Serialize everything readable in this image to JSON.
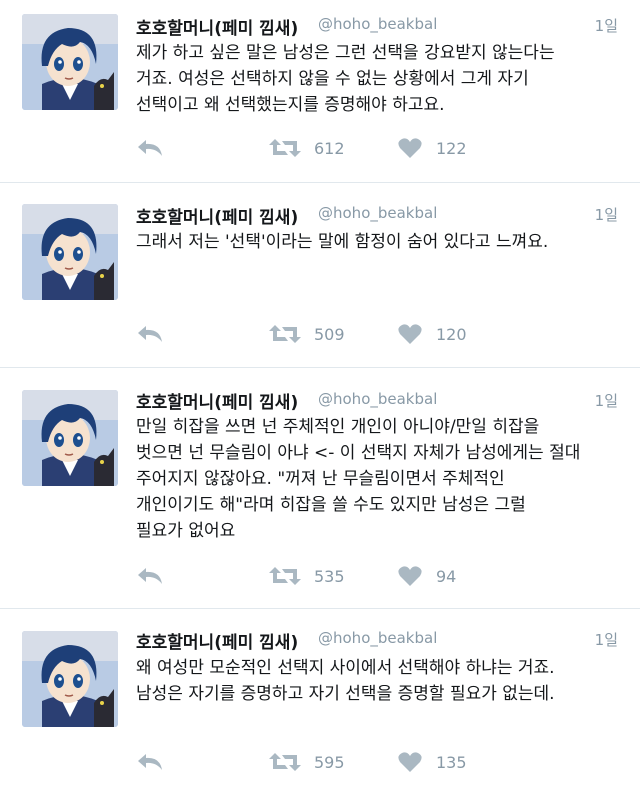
{
  "user": {
    "display_name": "호호할머니(페미 낌새)",
    "handle": "@hoho_beakbal",
    "avatar_icon": "anime-avatar-icon"
  },
  "colors": {
    "text": "#14171a",
    "muted": "#8899a6",
    "icon": "#aab8c2",
    "divider": "#e1e8ed"
  },
  "tweets": [
    {
      "time": "1일",
      "lines": [
        "제가 하고 싶은 말은 남성은 그런 선택을 강요받지 않는다는",
        "거죠. 여성은 선택하지 않을 수 없는 상황에서 그게 자기",
        "선택이고 왜 선택했는지를 증명해야 하고요."
      ],
      "retweets": "612",
      "likes": "122"
    },
    {
      "time": "1일",
      "lines": [
        "그래서 저는 '선택'이라는 말에 함정이 숨어 있다고 느껴요."
      ],
      "retweets": "509",
      "likes": "120"
    },
    {
      "time": "1일",
      "lines": [
        "만일 히잡을 쓰면 넌 주체적인 개인이 아니야/만일 히잡을",
        "벗으면 넌 무슬림이 아냐 <- 이 선택지 자체가 남성에게는 절대",
        "주어지지 않잖아요. \"꺼져 난 무슬림이면서 주체적인",
        "개인이기도 해\"라며 히잡을 쓸 수도 있지만 남성은 그럴",
        "필요가 없어요"
      ],
      "retweets": "535",
      "likes": "94"
    },
    {
      "time": "1일",
      "lines": [
        "왜 여성만 모순적인 선택지 사이에서 선택해야 하냐는 거죠.",
        "남성은 자기를 증명하고 자기 선택을 증명할 필요가 없는데."
      ],
      "retweets": "595",
      "likes": "135"
    }
  ]
}
